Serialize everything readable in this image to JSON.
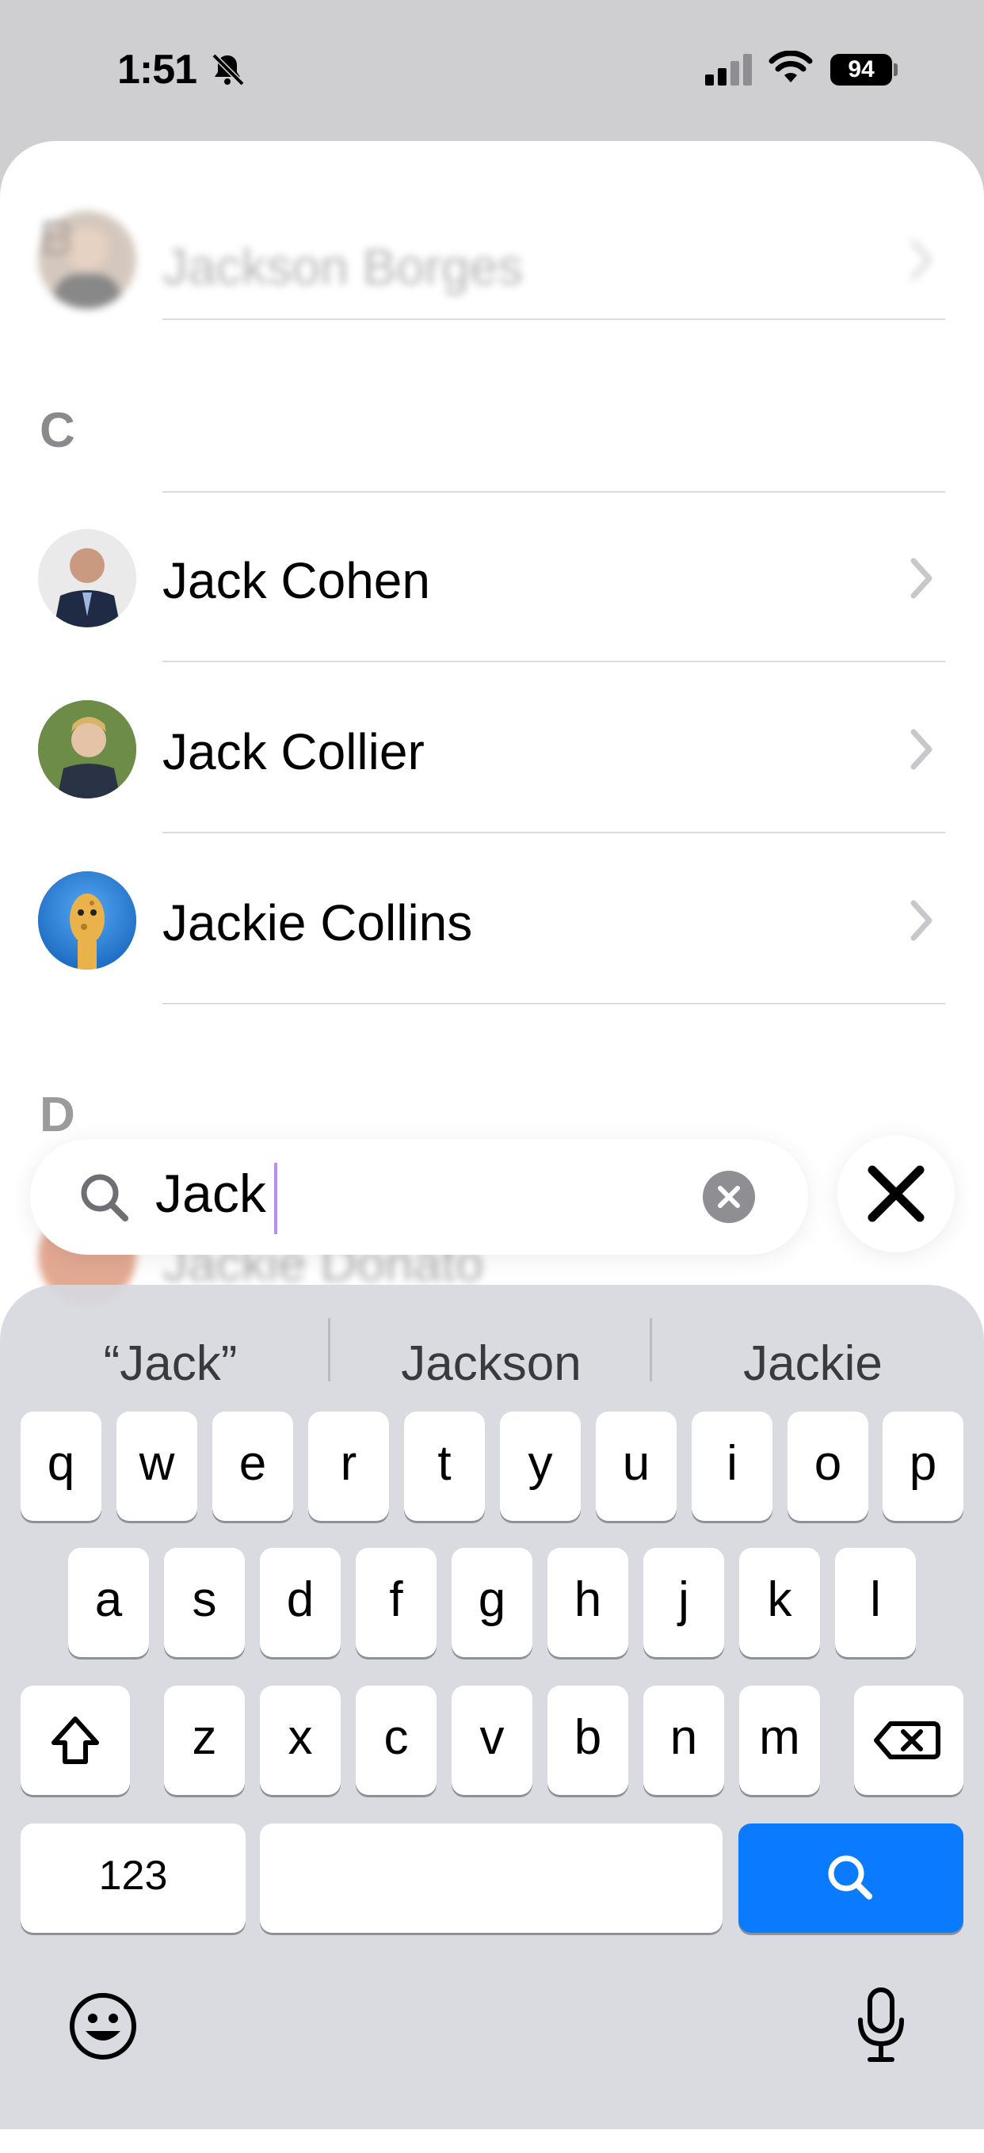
{
  "status": {
    "time": "1:51",
    "battery": "94"
  },
  "contacts": {
    "sections": [
      {
        "letter": "B"
      },
      {
        "letter": "C"
      },
      {
        "letter": "D"
      }
    ],
    "rows": [
      {
        "name": "Jackson Borges"
      },
      {
        "name": "Jack Cohen"
      },
      {
        "name": "Jack Collier"
      },
      {
        "name": "Jackie Collins"
      },
      {
        "name": "Jackie Donato"
      }
    ]
  },
  "search": {
    "query": "Jack"
  },
  "keyboard": {
    "suggestions": [
      "“Jack”",
      "Jackson",
      "Jackie"
    ],
    "row1": [
      "q",
      "w",
      "e",
      "r",
      "t",
      "y",
      "u",
      "i",
      "o",
      "p"
    ],
    "row2": [
      "a",
      "s",
      "d",
      "f",
      "g",
      "h",
      "j",
      "k",
      "l"
    ],
    "row3": [
      "z",
      "x",
      "c",
      "v",
      "b",
      "n",
      "m"
    ],
    "numbers_label": "123"
  },
  "colors": {
    "accent": "#0a7bff",
    "section_letter": "#8a8a8e"
  }
}
